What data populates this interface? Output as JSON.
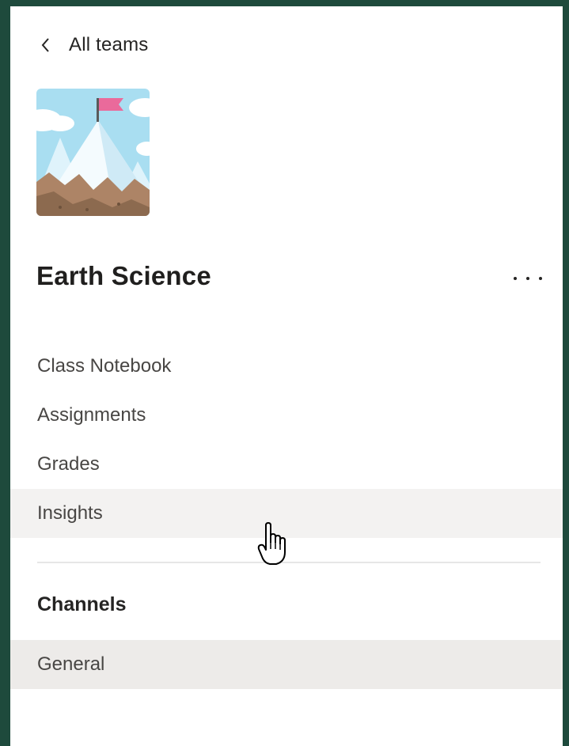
{
  "nav": {
    "back_label": "All teams"
  },
  "team": {
    "name": "Earth Science",
    "avatar_icon": "mountain-flag-icon"
  },
  "tabs": [
    {
      "label": "Class Notebook"
    },
    {
      "label": "Assignments"
    },
    {
      "label": "Grades"
    },
    {
      "label": "Insights",
      "state": "hover"
    }
  ],
  "channels": {
    "heading": "Channels",
    "items": [
      {
        "label": "General",
        "state": "selected"
      }
    ]
  },
  "colors": {
    "frame": "#1e4a3c",
    "panel_bg": "#ffffff",
    "hover_bg": "#f3f2f1",
    "selected_bg": "#edebe9",
    "text_primary": "#252423",
    "text_secondary": "#484644"
  }
}
